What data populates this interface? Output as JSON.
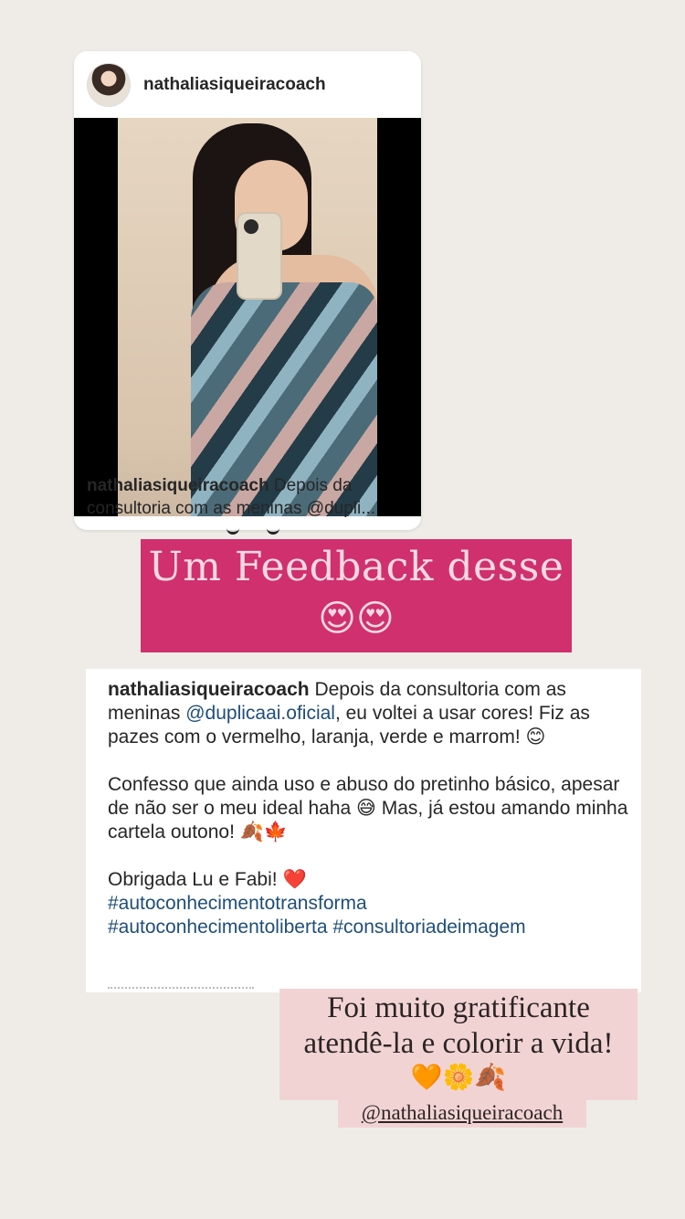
{
  "post": {
    "username": "nathaliasiqueiracoach",
    "caption_user": "nathaliasiqueiracoach",
    "caption_text": "Depois da consultoria com as meninas @dupli..."
  },
  "banner": {
    "text": "Um Feedback desse",
    "emoji": "😍😍"
  },
  "caption": {
    "username": "nathaliasiqueiracoach",
    "p1_before": "Depois da consultoria com as meninas ",
    "p1_mention": "@duplicaai.oficial",
    "p1_after": ", eu voltei a usar cores! Fiz as pazes com o vermelho, laranja, verde e marrom! 😊",
    "p2": "Confesso que ainda uso e abuso do pretinho básico, apesar de não ser o meu ideal haha 😅 Mas, já estou amando minha cartela outono! 🍂🍁",
    "p3": "Obrigada Lu e Fabi! ❤️",
    "hashtag1": "#autoconhecimentotransforma",
    "hashtag2": "#autoconhecimentoliberta",
    "hashtag3": "#consultoriadeimagem"
  },
  "note": {
    "line1": "Foi muito gratificante",
    "line2": "atendê-la e colorir a vida!",
    "emoji": "🧡🌼🍂",
    "tag": "@nathaliasiqueiracoach"
  },
  "colors": {
    "background": "#efece8",
    "banner": "#d0306e",
    "note": "#f2d3d3",
    "link": "#1f4e79"
  }
}
